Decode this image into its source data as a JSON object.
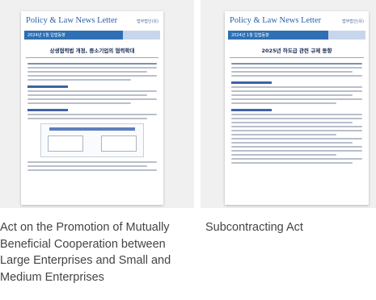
{
  "cards": [
    {
      "doc_title": "Policy & Law News Letter",
      "doc_logo": "법무법인(유)",
      "doc_band": "2024년 1월 입법동향",
      "doc_heading": "상생협력법 개정, 중소기업의 협력확대",
      "caption": "Act on the Promotion of Mutually Beneficial Cooperation between Large Enterprises and Small and Medium Enterprises"
    },
    {
      "doc_title": "Policy & Law News Letter",
      "doc_logo": "법무법인(유)",
      "doc_band": "2024년 1월 입법동향",
      "doc_heading": "2025년 하도급 관련 규제 동향",
      "caption": "Subcontracting Act"
    }
  ]
}
